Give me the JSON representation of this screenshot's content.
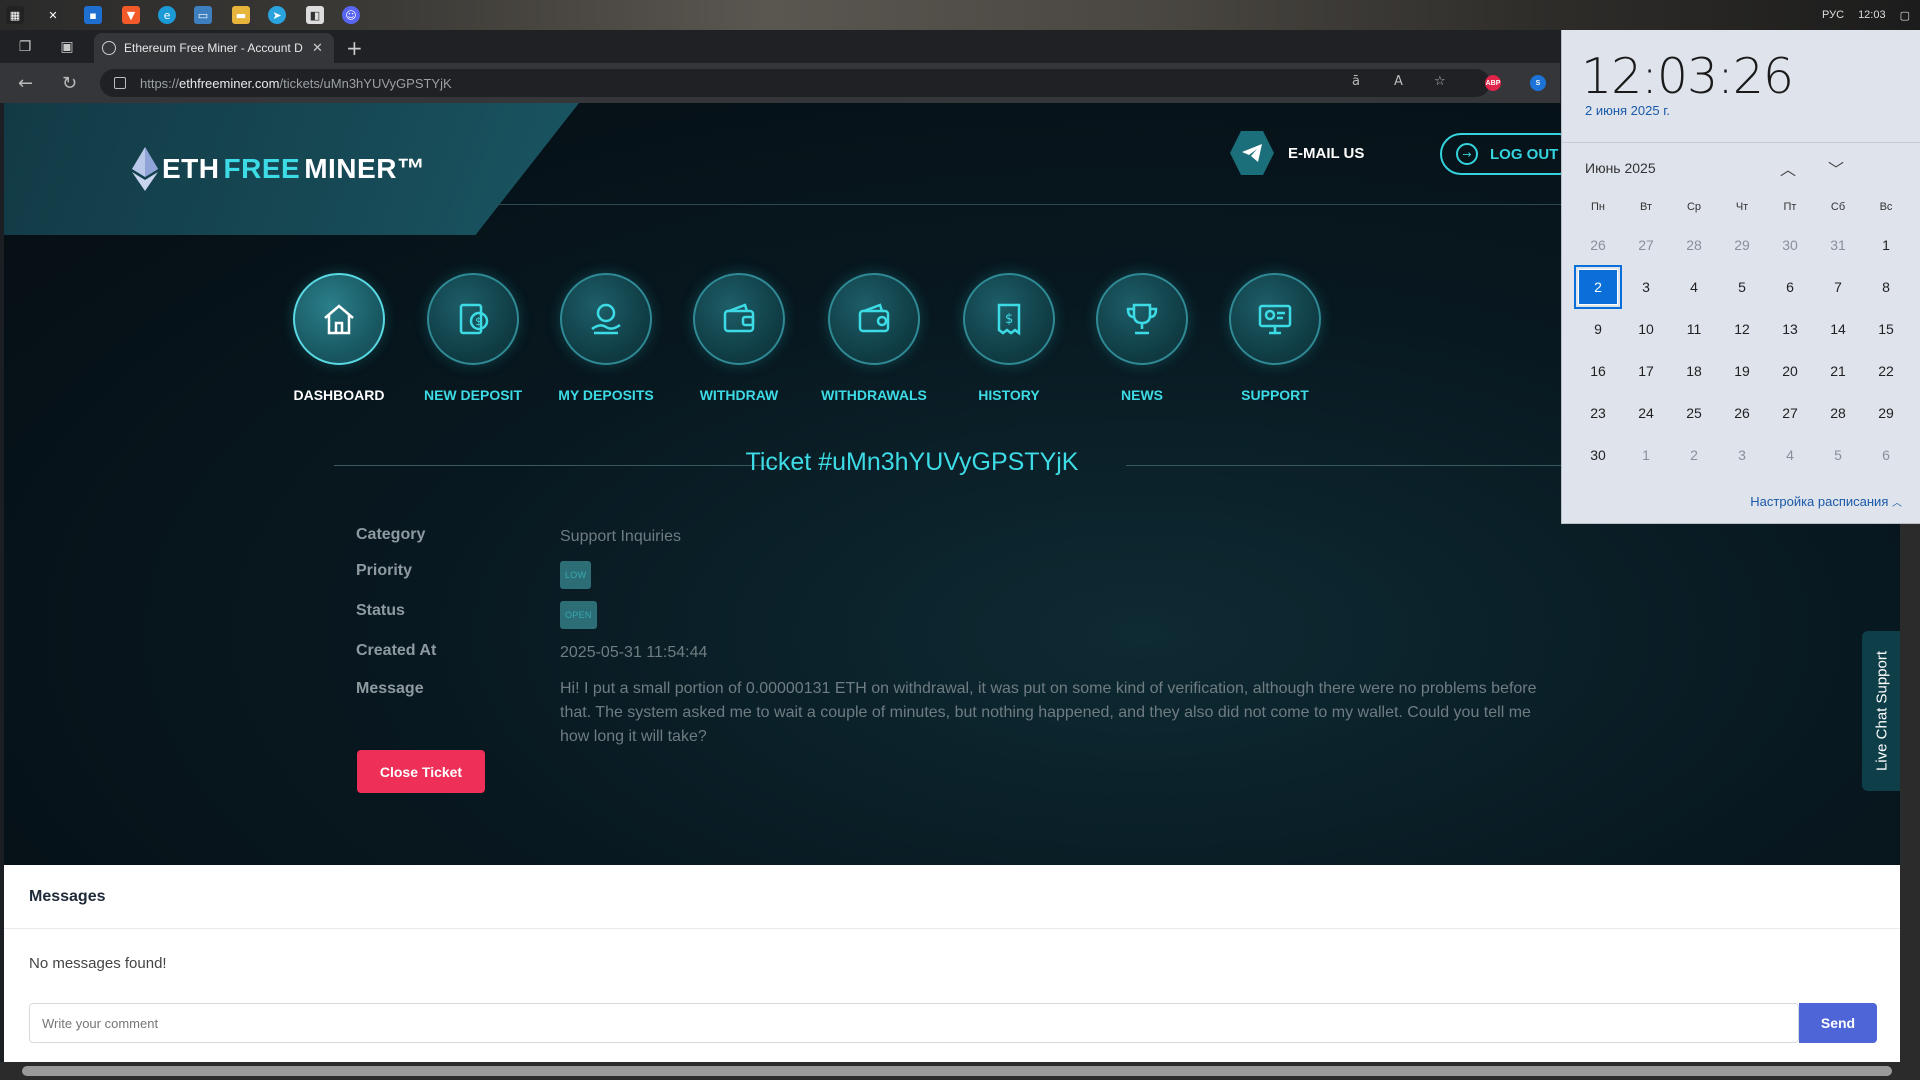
{
  "taskbar": {
    "icons": [
      "windows-icon",
      "x-icon",
      "store-icon",
      "brave-icon",
      "edge-icon",
      "monitor-icon",
      "folder-icon",
      "telegram-icon",
      "app-icon",
      "discord-icon"
    ],
    "tray_lang": "РУС",
    "tray_time": "12:03"
  },
  "browser": {
    "tab_title": "Ethereum Free Miner - Account D",
    "url_prefix": "https://",
    "url_domain": "ethfreeminer.com",
    "url_path": "/tickets/uMn3hYUVyGPSTYjK",
    "ext_abp": "ABP"
  },
  "site": {
    "logo_part1": "ETH",
    "logo_part2": "FREE",
    "logo_part3": "MINER™",
    "email_label": "E-MAIL US",
    "logout_label": "LOG OUT",
    "nav": [
      {
        "label": "DASHBOARD",
        "icon": "home-icon",
        "active": true
      },
      {
        "label": "NEW DEPOSIT",
        "icon": "deposit-icon",
        "active": false
      },
      {
        "label": "MY DEPOSITS",
        "icon": "coin-hand-icon",
        "active": false
      },
      {
        "label": "WITHDRAW",
        "icon": "wallet-icon",
        "active": false
      },
      {
        "label": "WITHDRAWALS",
        "icon": "wallet-list-icon",
        "active": false
      },
      {
        "label": "HISTORY",
        "icon": "receipt-icon",
        "active": false
      },
      {
        "label": "NEWS",
        "icon": "trophy-icon",
        "active": false
      },
      {
        "label": "SUPPORT",
        "icon": "support-monitor-icon",
        "active": false
      }
    ]
  },
  "ticket": {
    "title": "Ticket #uMn3hYUVyGPSTYjK",
    "category_label": "Category",
    "category_value": "Support Inquiries",
    "priority_label": "Priority",
    "priority_value": "LOW",
    "status_label": "Status",
    "status_value": "OPEN",
    "created_label": "Created At",
    "created_value": "2025-05-31 11:54:44",
    "message_label": "Message",
    "message_value": "Hi! I put a small portion of 0.00000131 ETH on withdrawal, it was put on some kind of verification, although there were no problems before that. The system asked me to wait a couple of minutes, but nothing happened, and they also did not come to my wallet. Could you tell me how long it will take?",
    "close_button": "Close Ticket"
  },
  "messages": {
    "heading": "Messages",
    "empty_text": "No messages found!",
    "comment_placeholder": "Write your comment",
    "send_button": "Send"
  },
  "live_chat": "Live Chat Support",
  "calendar": {
    "time": "12:03:26",
    "date_text": "2 июня 2025 г.",
    "month_label": "Июнь 2025",
    "weekdays": [
      "Пн",
      "Вт",
      "Ср",
      "Чт",
      "Пт",
      "Сб",
      "Вс"
    ],
    "weeks": [
      [
        "26",
        "27",
        "28",
        "29",
        "30",
        "31",
        "1"
      ],
      [
        "2",
        "3",
        "4",
        "5",
        "6",
        "7",
        "8"
      ],
      [
        "9",
        "10",
        "11",
        "12",
        "13",
        "14",
        "15"
      ],
      [
        "16",
        "17",
        "18",
        "19",
        "20",
        "21",
        "22"
      ],
      [
        "23",
        "24",
        "25",
        "26",
        "27",
        "28",
        "29"
      ],
      [
        "30",
        "1",
        "2",
        "3",
        "4",
        "5",
        "6"
      ]
    ],
    "dim_cells": [
      [
        0,
        0
      ],
      [
        0,
        1
      ],
      [
        0,
        2
      ],
      [
        0,
        3
      ],
      [
        0,
        4
      ],
      [
        0,
        5
      ],
      [
        5,
        1
      ],
      [
        5,
        2
      ],
      [
        5,
        3
      ],
      [
        5,
        4
      ],
      [
        5,
        5
      ],
      [
        5,
        6
      ]
    ],
    "today": [
      1,
      0
    ],
    "schedule_link": "Настройка расписания"
  },
  "colors": {
    "accent": "#3ddbe5",
    "close_button": "#ee2f57",
    "send_button": "#4d65d6",
    "today": "#0a6fd8"
  }
}
